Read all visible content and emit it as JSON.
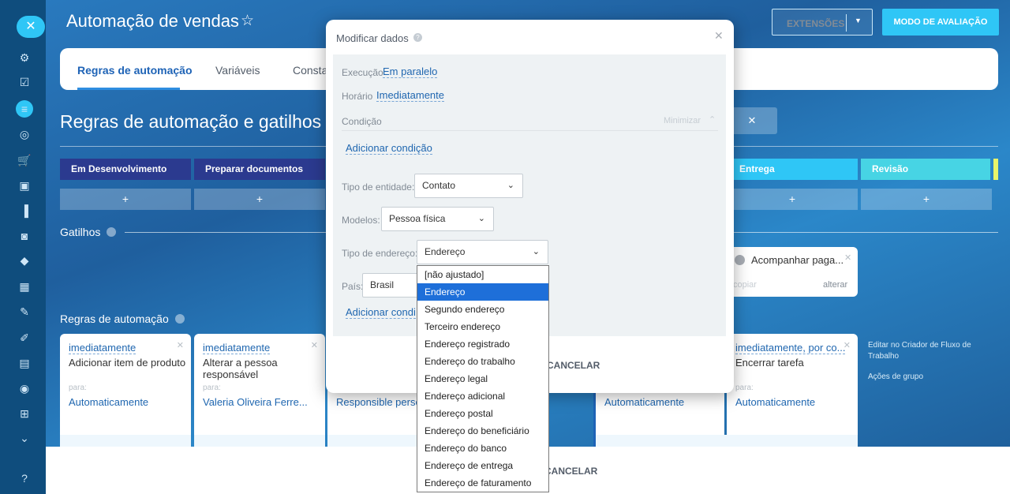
{
  "header": {
    "title": "Automação de vendas",
    "extensions_label": "EXTENSÕES",
    "trial_label": "MODO DE AVALIAÇÃO"
  },
  "tabs": [
    {
      "label": "Regras de automação"
    },
    {
      "label": "Variáveis"
    },
    {
      "label": "Consta"
    }
  ],
  "page": {
    "heading": "Regras de automação e gatilhos"
  },
  "stages": [
    {
      "label": "Em Desenvolvimento",
      "color": "#2b3a8f"
    },
    {
      "label": "Preparar documentos",
      "color": "#2b3a8f"
    },
    {
      "label": "Entrega",
      "color": "#2fc6f6"
    },
    {
      "label": "Revisão",
      "color": "#47d4e4"
    }
  ],
  "add_label": "+",
  "triggers": {
    "label": "Gatilhos",
    "card": {
      "name": "Acompanhar paga...",
      "copy": "copiar",
      "change": "alterar"
    }
  },
  "robots": {
    "label": "Regras de automação",
    "cards": [
      {
        "condition": "imediatamente",
        "name": "Adicionar item de produto",
        "for_label": "para:",
        "assignee": "Automaticamente"
      },
      {
        "condition": "imediatamente",
        "name": "Alterar a pessoa responsável",
        "for_label": "para:",
        "assignee": "Valeria Oliveira Ferre..."
      },
      {
        "assignee": "Responsible person"
      },
      {
        "assignee": "Automaticamente"
      },
      {
        "condition": "imediatamente, por co...",
        "name": "Encerrar tarefa",
        "for_label": "para:",
        "assignee": "Automaticamente"
      }
    ],
    "side_edit": "Editar no Criador de Fluxo de Trabalho",
    "side_group": "Ações de grupo"
  },
  "bottom": {
    "cancel": "CANCELAR"
  },
  "modal": {
    "title": "Modificar dados",
    "execution_label": "Execução",
    "execution_value": "Em paralelo",
    "time_label": "Horário",
    "time_value": "Imediatamente",
    "condition_label": "Condição",
    "minimize_label": "Minimizar",
    "add_condition": "Adicionar condição",
    "entity_type_label": "Tipo de entidade:",
    "entity_type_value": "Contato",
    "models_label": "Modelos:",
    "models_value": "Pessoa física",
    "address_type_label": "Tipo de endereço:",
    "address_type_value": "Endereço",
    "country_label": "País:",
    "country_value": "Brasil",
    "add_condition_2": "Adicionar condi",
    "cancel": "CANCELAR"
  },
  "address_options": [
    "[não ajustado]",
    "Endereço",
    "Segundo endereço",
    "Terceiro endereço",
    "Endereço registrado",
    "Endereço do trabalho",
    "Endereço legal",
    "Endereço adicional",
    "Endereço postal",
    "Endereço do beneficiário",
    "Endereço do banco",
    "Endereço de entrega",
    "Endereço de faturamento"
  ],
  "address_selected": "Endereço"
}
